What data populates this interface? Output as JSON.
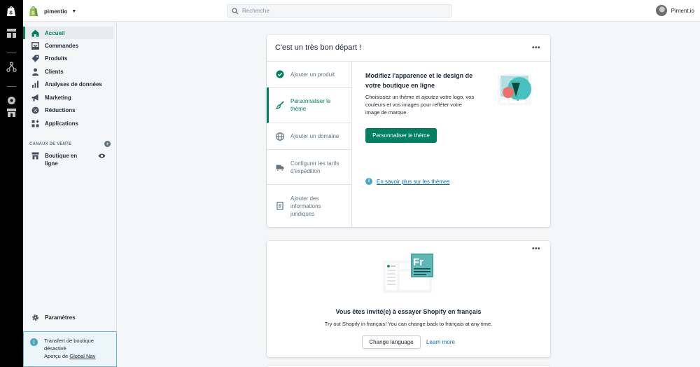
{
  "nav_rail": {
    "icons": [
      "shopify-logo-icon",
      "dashboard-icon",
      "network-icon",
      "apps-icon",
      "store-icon"
    ]
  },
  "topbar": {
    "store_name": "pimentio",
    "search_placeholder": "Recherche",
    "user_name": "Piment.io"
  },
  "sidebar": {
    "items": [
      {
        "label": "Accueil",
        "icon": "home-icon",
        "active": true
      },
      {
        "label": "Commandes",
        "icon": "orders-icon"
      },
      {
        "label": "Produits",
        "icon": "tag-icon"
      },
      {
        "label": "Clients",
        "icon": "person-icon"
      },
      {
        "label": "Analyses de données",
        "icon": "bar-chart-icon"
      },
      {
        "label": "Marketing",
        "icon": "megaphone-icon"
      },
      {
        "label": "Réductions",
        "icon": "discount-icon"
      },
      {
        "label": "Applications",
        "icon": "apps-icon"
      }
    ],
    "sales_channels_header": "CANAUX DE VENTE",
    "channel": {
      "label": "Boutique en ligne",
      "icon": "store-icon"
    },
    "settings_label": "Paramètres",
    "notice": {
      "line1": "Transfert de boutique",
      "line2": "désactivé",
      "line3_prefix": "Aperçu de",
      "line3_link": "Global Nav"
    }
  },
  "setup_card": {
    "title": "C'est un très bon départ !",
    "steps": [
      {
        "label": "Ajouter un produit",
        "icon": "check-circle-icon",
        "done": true
      },
      {
        "label": "Personnaliser le thème",
        "icon": "paintbrush-icon",
        "active": true
      },
      {
        "label": "Ajouter un domaine",
        "icon": "globe-icon"
      },
      {
        "label": "Configurer les tarifs d'expédition",
        "icon": "truck-icon"
      },
      {
        "label": "Ajouter des informations juridiques",
        "icon": "document-icon"
      }
    ],
    "active_step": {
      "heading": "Modifiez l'apparence et le design de votre boutique en ligne",
      "description": "Choisissez un thème et ajoutez votre logo, vos couleurs et vos images pour refléter votre image de marque.",
      "button": "Personnaliser le thème",
      "learn_more": "En savoir plus sur les thèmes"
    }
  },
  "language_card": {
    "illustration_text": "Fr",
    "title": "Vous êtes invité(e) à essayer Shopify en français",
    "subtitle": "Try out Shopify in français! You can change back to français at any time.",
    "primary_button": "Change language",
    "secondary_link": "Learn more"
  },
  "colors": {
    "accent": "#008060",
    "link": "#006fbb",
    "info": "#47a6c3"
  }
}
